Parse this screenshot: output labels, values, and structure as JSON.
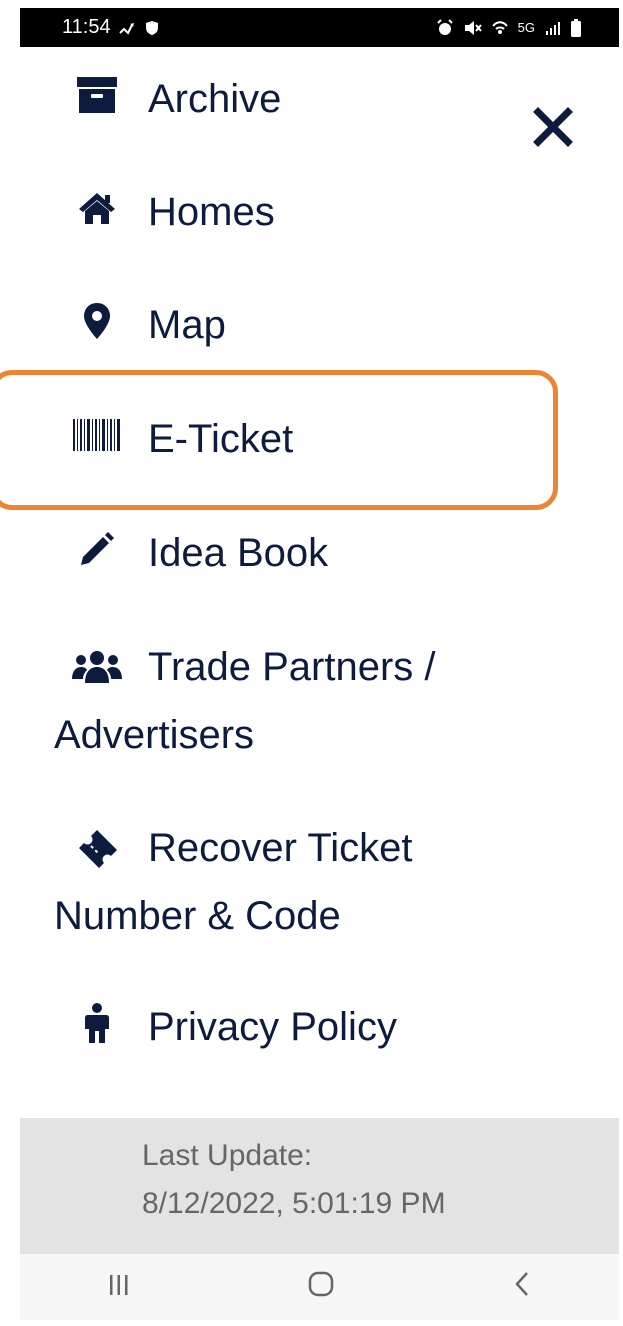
{
  "status_bar": {
    "time": "11:54",
    "network_label": "5G",
    "icons": [
      "missed-call-icon",
      "shield-icon",
      "alarm-icon",
      "mute-icon",
      "wifi-icon",
      "signal-icon",
      "battery-icon"
    ]
  },
  "menu": {
    "items": [
      {
        "label": "Archive",
        "icon": "archive-box-icon"
      },
      {
        "label": "Homes",
        "icon": "home-icon"
      },
      {
        "label": "Map",
        "icon": "map-pin-icon"
      },
      {
        "label": "E-Ticket",
        "icon": "barcode-icon",
        "highlighted": true
      },
      {
        "label": "Idea Book",
        "icon": "pencil-icon"
      },
      {
        "label_line1": "Trade Partners /",
        "label_line2": "Advertisers",
        "icon": "users-icon"
      },
      {
        "label_line1": "Recover Ticket",
        "label_line2": "Number & Code",
        "icon": "ticket-icon"
      },
      {
        "label": "Privacy Policy",
        "icon": "person-icon"
      }
    ]
  },
  "footer": {
    "line1": "Last Update:",
    "line2": "8/12/2022, 5:01:19 PM"
  },
  "colors": {
    "text": "#0d1b3e",
    "highlight": "#ee8433",
    "footer_bg": "#e3e3e3",
    "footer_text": "#666666"
  }
}
